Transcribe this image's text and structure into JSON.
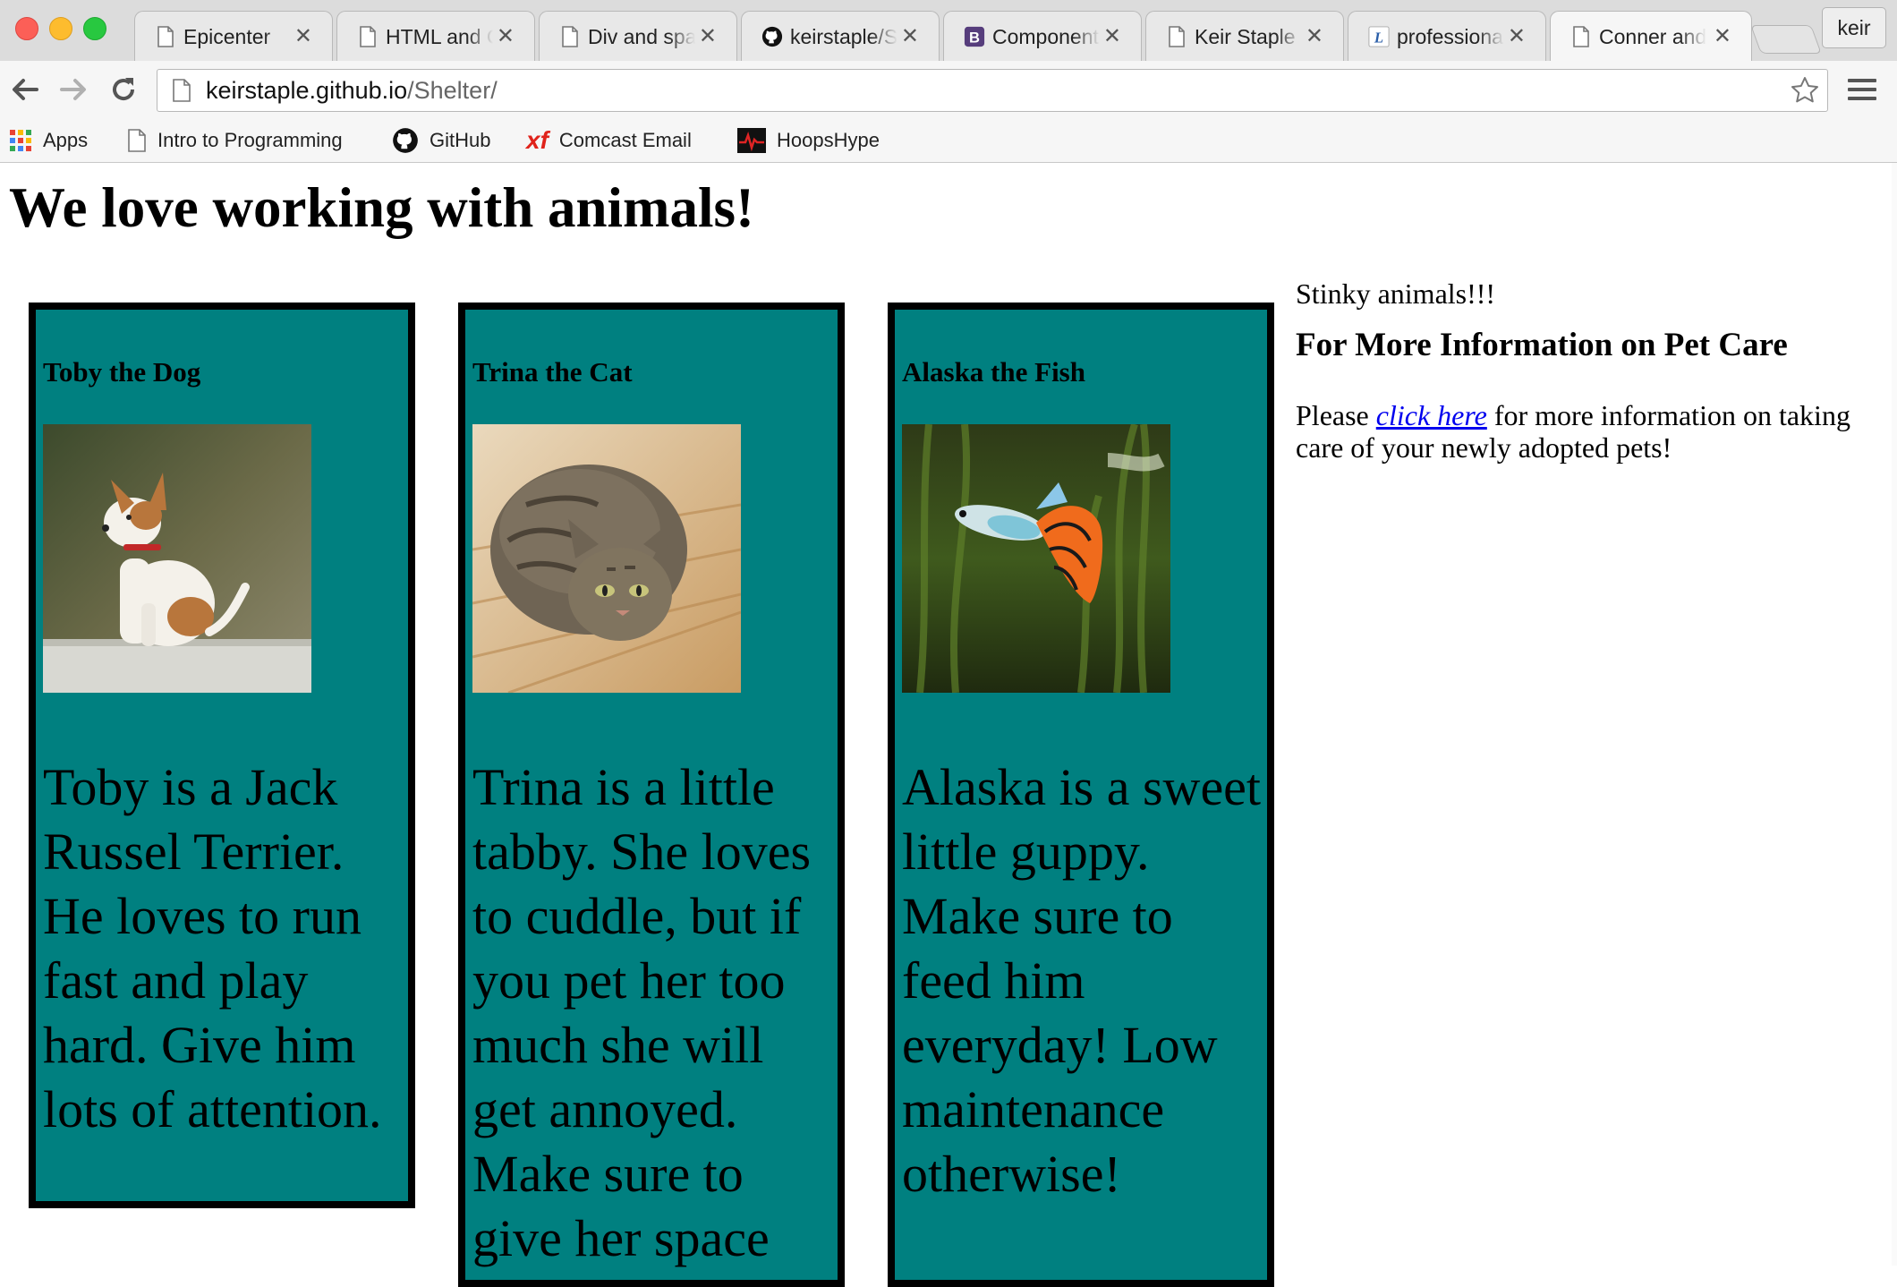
{
  "browser": {
    "tabs": [
      {
        "title": "Epicenter",
        "icon": "page-icon"
      },
      {
        "title": "HTML and CSS",
        "icon": "page-icon"
      },
      {
        "title": "Div and span",
        "icon": "page-icon"
      },
      {
        "title": "keirstaple/Shelter",
        "icon": "github-icon"
      },
      {
        "title": "Components",
        "icon": "bootstrap-icon"
      },
      {
        "title": "Keir Staple",
        "icon": "page-icon"
      },
      {
        "title": "professional",
        "icon": "linkedin-icon"
      },
      {
        "title": "Conner and",
        "icon": "page-icon"
      }
    ],
    "profile_name": "keir",
    "url_host": "keirstaple.github.io",
    "url_path": "/Shelter/",
    "bookmarks": [
      {
        "label": "Apps",
        "icon": "apps-grid-icon"
      },
      {
        "label": "Intro to Programming",
        "icon": "page-icon"
      },
      {
        "label": "GitHub",
        "icon": "github-icon"
      },
      {
        "label": "Comcast Email",
        "icon": "xfinity-icon"
      },
      {
        "label": "HoopsHype",
        "icon": "hoopshype-icon"
      }
    ],
    "accent_colors": {
      "close_red": "#fc5f57",
      "minimize_yellow": "#fdbc2e",
      "zoom_green": "#28c840"
    }
  },
  "page": {
    "title": "We love working with animals!",
    "card_color": "#008080",
    "animals": [
      {
        "name": "Toby the Dog",
        "photo": "dog-photo",
        "description": "Toby is a Jack Russel Terrier. He loves to run fast and play hard. Give him lots of attention."
      },
      {
        "name": "Trina the Cat",
        "photo": "cat-photo",
        "description": "Trina is a little tabby. She loves to cuddle, but if you pet her too much she will get annoyed. Make sure to give her space"
      },
      {
        "name": "Alaska the Fish",
        "photo": "fish-photo",
        "description": "Alaska is a sweet little guppy. Make sure to feed him everyday! Low maintenance otherwise!"
      }
    ],
    "aside": {
      "note": "Stinky animals!!!",
      "heading": "For More Information on Pet Care",
      "para_before": "Please ",
      "link_text": "click here",
      "para_after": " for more information on taking care of your newly adopted pets!",
      "link_color": "#0000ee"
    }
  }
}
